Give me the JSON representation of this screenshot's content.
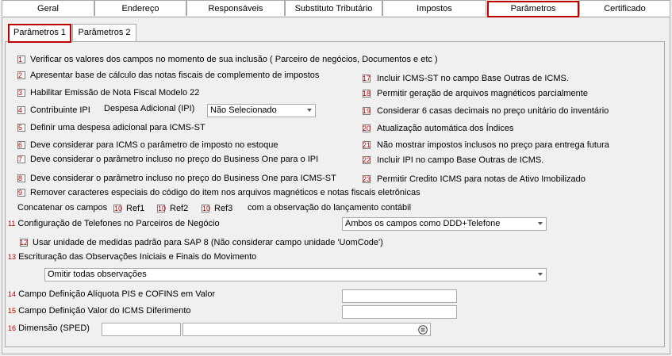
{
  "top_tabs": [
    "Geral",
    "Endereço",
    "Responsáveis",
    "Substituto Tributário",
    "Impostos",
    "Parâmetros",
    "Certificado"
  ],
  "sub_tabs": [
    "Parâmetros 1",
    "Parâmetros 2"
  ],
  "left_items": [
    {
      "num": "1",
      "label": "Verificar os valores dos campos no momento de sua inclusão ( Parceiro de negócios, Documentos e etc )"
    },
    {
      "num": "2",
      "label": "Apresentar base de cálculo das notas fiscais de complemento de impostos"
    },
    {
      "num": "3",
      "label": "Habilitar Emissão de Nota Fiscal Modelo 22"
    },
    {
      "num": "4",
      "label": "Contribuinte IPI"
    },
    {
      "num": "5",
      "label": "Definir uma despesa adicional para ICMS-ST"
    },
    {
      "num": "6",
      "label": "Deve considerar para ICMS o parâmetro de imposto no estoque"
    },
    {
      "num": "7",
      "label": "Deve considerar o parâmetro incluso no preço do Business One para o IPI"
    },
    {
      "num": "8",
      "label": "Deve considerar o parâmetro incluso no preço do Business One para ICMS-ST"
    },
    {
      "num": "9",
      "label": "Remover caracteres especiais do código do item nos arquivos magnéticos e notas fiscais eletrônicas"
    }
  ],
  "right_items": [
    {
      "num": "17",
      "label": "Incluir ICMS-ST no campo Base Outras de ICMS."
    },
    {
      "num": "18",
      "label": "Permitir geração de arquivos magnéticos parcialmente"
    },
    {
      "num": "19",
      "label": "Considerar 6 casas decimais no preço unitário do inventário"
    },
    {
      "num": "20",
      "label": "Atualização automática dos Índices"
    },
    {
      "num": "21",
      "label": "Não mostrar impostos inclusos no preço para entrega futura"
    },
    {
      "num": "22",
      "label": "Incluir IPI no campo Base Outras de ICMS."
    },
    {
      "num": "23",
      "label": "Permitir Credito ICMS para notas de Ativo Imobilizado"
    }
  ],
  "despesa": {
    "label": "Despesa Adicional (IPI)",
    "value": "Não Selecionado"
  },
  "concat": {
    "label": "Concatenar os campos",
    "refs": [
      {
        "num": "10",
        "label": "Ref1"
      },
      {
        "num": "10",
        "label": "Ref2"
      },
      {
        "num": "10",
        "label": "Ref3"
      }
    ],
    "suffix": "com a observação do lançamento contábil"
  },
  "item11": {
    "num": "11",
    "label": "Configuração de Telefones no Parceiros de Negócio",
    "value": "Ambos os campos como DDD+Telefone"
  },
  "item12": {
    "num": "12",
    "label": "Usar unidade de medidas padrão para SAP 8 (Não considerar campo unidade 'UomCode')"
  },
  "item13": {
    "num": "13",
    "label": "Escrituração das Observações Iniciais e Finais do Movimento",
    "value": "Omitir todas observações"
  },
  "item14": {
    "num": "14",
    "label": "Campo Definição Alíquota PIS e COFINS em Valor",
    "value": ""
  },
  "item15": {
    "num": "15",
    "label": "Campo Definição Valor do ICMS Diferimento",
    "value": ""
  },
  "item16": {
    "num": "16",
    "label": "Dimensão (SPED)",
    "value1": "",
    "value2": ""
  }
}
